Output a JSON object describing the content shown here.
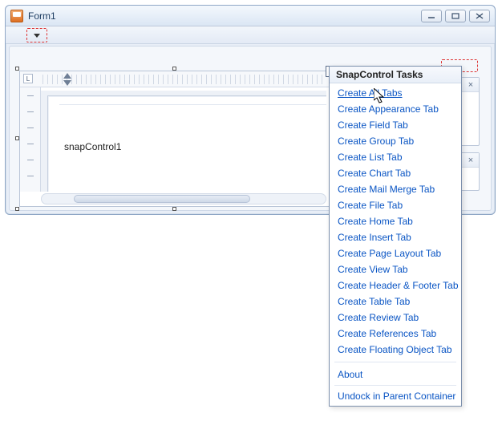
{
  "window": {
    "title": "Form1"
  },
  "snap": {
    "ruler_corner": "L",
    "placeholder_text": "snapControl1"
  },
  "tasks": {
    "title": "SnapControl Tasks",
    "hovered_index": 0,
    "items": [
      "Create All Tabs",
      "Create Appearance Tab",
      "Create Field Tab",
      "Create Group Tab",
      "Create List Tab",
      "Create Chart Tab",
      "Create Mail Merge Tab",
      "Create File Tab",
      "Create Home Tab",
      "Create Insert Tab",
      "Create Page Layout Tab",
      "Create View Tab",
      "Create Header & Footer Tab",
      "Create Table Tab",
      "Create Review Tab",
      "Create References Tab",
      "Create Floating Object Tab"
    ],
    "footer_items": [
      "About",
      "Undock in Parent Container"
    ]
  }
}
